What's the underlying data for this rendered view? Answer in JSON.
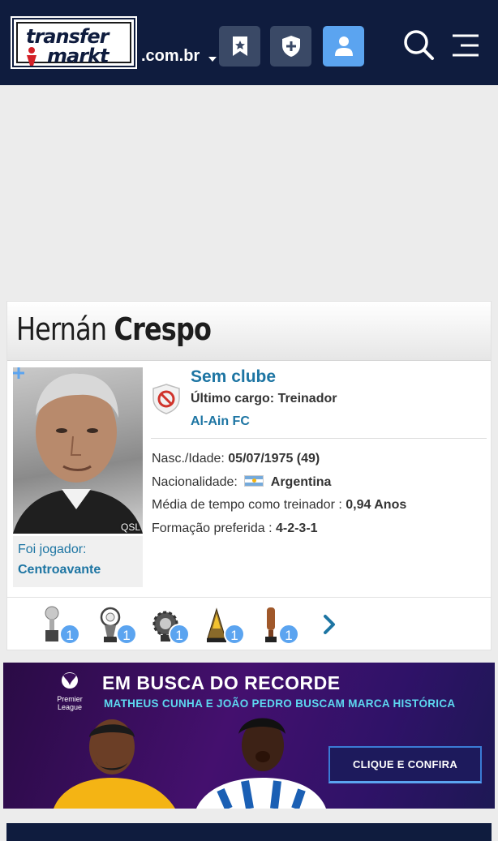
{
  "header": {
    "logo_line1": "transfer",
    "logo_line2": "markt",
    "domain": ".com.br",
    "bookmark_icon": "bookmark-star-icon",
    "shield_icon": "shield-plus-icon",
    "user_icon": "user-icon",
    "search_icon": "search-icon",
    "menu_icon": "hamburger-menu-icon",
    "colors": {
      "bg": "#0f1c3e",
      "button": "#3a4966",
      "button_active": "#5ba4f0"
    }
  },
  "profile": {
    "first_name": "Hernán",
    "last_name": "Crespo",
    "photo_credit": "QSL",
    "former_label": "Foi jogador:",
    "former_position": "Centroavante",
    "club_status": "Sem clube",
    "last_role": "Último cargo: Treinador",
    "last_club": "Al-Ain FC",
    "info": [
      {
        "label": "Nasc./Idade:",
        "value": "05/07/1975 (49)"
      },
      {
        "label": "Nacionalidade:",
        "value": "Argentina"
      },
      {
        "label": "Média de tempo como treinador :",
        "value": "0,94 Anos"
      },
      {
        "label": "Formação preferida :",
        "value": "4-2-3-1"
      }
    ],
    "trophies": [
      {
        "icon": "trophy-silver-icon",
        "count": "1"
      },
      {
        "icon": "trophy-globe-icon",
        "count": "1"
      },
      {
        "icon": "trophy-gear-icon",
        "count": "1"
      },
      {
        "icon": "trophy-pyramid-icon",
        "count": "1"
      },
      {
        "icon": "trophy-bronze-icon",
        "count": "1"
      }
    ],
    "colors": {
      "link": "#1d75a3",
      "badge": "#5ba4f0"
    }
  },
  "banner": {
    "league_text": "Premier League",
    "title": "EM BUSCA DO RECORDE",
    "subtitle": "MATHEUS CUNHA E JOÃO PEDRO BUSCAM MARCA HISTÓRICA",
    "cta": "CLIQUE E CONFIRA"
  }
}
